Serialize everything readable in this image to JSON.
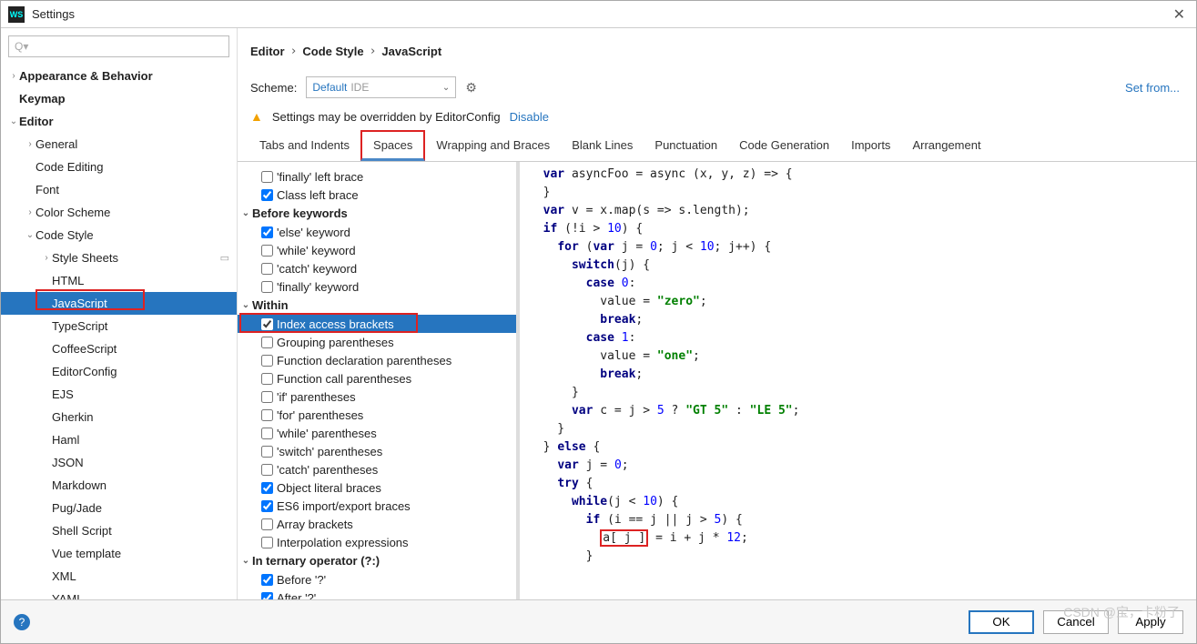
{
  "window": {
    "title": "Settings"
  },
  "search": {
    "placeholder": "Q▾"
  },
  "tree": [
    {
      "indent": 0,
      "arrow": "›",
      "label": "Appearance & Behavior",
      "bold": true
    },
    {
      "indent": 0,
      "arrow": "",
      "label": "Keymap",
      "bold": true
    },
    {
      "indent": 0,
      "arrow": "⌄",
      "label": "Editor",
      "bold": true
    },
    {
      "indent": 1,
      "arrow": "›",
      "label": "General"
    },
    {
      "indent": 1,
      "arrow": "",
      "label": "Code Editing"
    },
    {
      "indent": 1,
      "arrow": "",
      "label": "Font"
    },
    {
      "indent": 1,
      "arrow": "›",
      "label": "Color Scheme"
    },
    {
      "indent": 1,
      "arrow": "⌄",
      "label": "Code Style"
    },
    {
      "indent": 2,
      "arrow": "›",
      "label": "Style Sheets",
      "tag": "▭"
    },
    {
      "indent": 2,
      "arrow": "",
      "label": "HTML"
    },
    {
      "indent": 2,
      "arrow": "",
      "label": "JavaScript",
      "selected": true
    },
    {
      "indent": 2,
      "arrow": "",
      "label": "TypeScript"
    },
    {
      "indent": 2,
      "arrow": "",
      "label": "CoffeeScript"
    },
    {
      "indent": 2,
      "arrow": "",
      "label": "EditorConfig"
    },
    {
      "indent": 2,
      "arrow": "",
      "label": "EJS"
    },
    {
      "indent": 2,
      "arrow": "",
      "label": "Gherkin"
    },
    {
      "indent": 2,
      "arrow": "",
      "label": "Haml"
    },
    {
      "indent": 2,
      "arrow": "",
      "label": "JSON"
    },
    {
      "indent": 2,
      "arrow": "",
      "label": "Markdown"
    },
    {
      "indent": 2,
      "arrow": "",
      "label": "Pug/Jade"
    },
    {
      "indent": 2,
      "arrow": "",
      "label": "Shell Script"
    },
    {
      "indent": 2,
      "arrow": "",
      "label": "Vue template"
    },
    {
      "indent": 2,
      "arrow": "",
      "label": "XML"
    },
    {
      "indent": 2,
      "arrow": "",
      "label": "YAML"
    }
  ],
  "breadcrumb": [
    "Editor",
    "Code Style",
    "JavaScript"
  ],
  "scheme": {
    "label": "Scheme:",
    "value": "Default",
    "suffix": "IDE"
  },
  "setfrom": "Set from...",
  "warning": {
    "text": "Settings may be overridden by EditorConfig",
    "action": "Disable"
  },
  "tabs": [
    "Tabs and Indents",
    "Spaces",
    "Wrapping and Braces",
    "Blank Lines",
    "Punctuation",
    "Code Generation",
    "Imports",
    "Arrangement"
  ],
  "active_tab": 1,
  "options": [
    {
      "type": "item",
      "label": "'finally' left brace",
      "checked": false
    },
    {
      "type": "item",
      "label": "Class left brace",
      "checked": true
    },
    {
      "type": "group",
      "label": "Before keywords"
    },
    {
      "type": "item",
      "label": "'else' keyword",
      "checked": true
    },
    {
      "type": "item",
      "label": "'while' keyword",
      "checked": false
    },
    {
      "type": "item",
      "label": "'catch' keyword",
      "checked": false
    },
    {
      "type": "item",
      "label": "'finally' keyword",
      "checked": false
    },
    {
      "type": "group",
      "label": "Within"
    },
    {
      "type": "item",
      "label": "Index access brackets",
      "checked": true,
      "selected": true
    },
    {
      "type": "item",
      "label": "Grouping parentheses",
      "checked": false
    },
    {
      "type": "item",
      "label": "Function declaration parentheses",
      "checked": false
    },
    {
      "type": "item",
      "label": "Function call parentheses",
      "checked": false
    },
    {
      "type": "item",
      "label": "'if' parentheses",
      "checked": false
    },
    {
      "type": "item",
      "label": "'for' parentheses",
      "checked": false
    },
    {
      "type": "item",
      "label": "'while' parentheses",
      "checked": false
    },
    {
      "type": "item",
      "label": "'switch' parentheses",
      "checked": false
    },
    {
      "type": "item",
      "label": "'catch' parentheses",
      "checked": false
    },
    {
      "type": "item",
      "label": "Object literal braces",
      "checked": true
    },
    {
      "type": "item",
      "label": "ES6 import/export braces",
      "checked": true
    },
    {
      "type": "item",
      "label": "Array brackets",
      "checked": false
    },
    {
      "type": "item",
      "label": "Interpolation expressions",
      "checked": false
    },
    {
      "type": "group",
      "label": "In ternary operator (?:)"
    },
    {
      "type": "item",
      "label": "Before '?'",
      "checked": true
    },
    {
      "type": "item",
      "label": "After '?'",
      "checked": true
    }
  ],
  "buttons": {
    "ok": "OK",
    "cancel": "Cancel",
    "apply": "Apply"
  },
  "watermark": "CSDN @宝，卡粉了"
}
